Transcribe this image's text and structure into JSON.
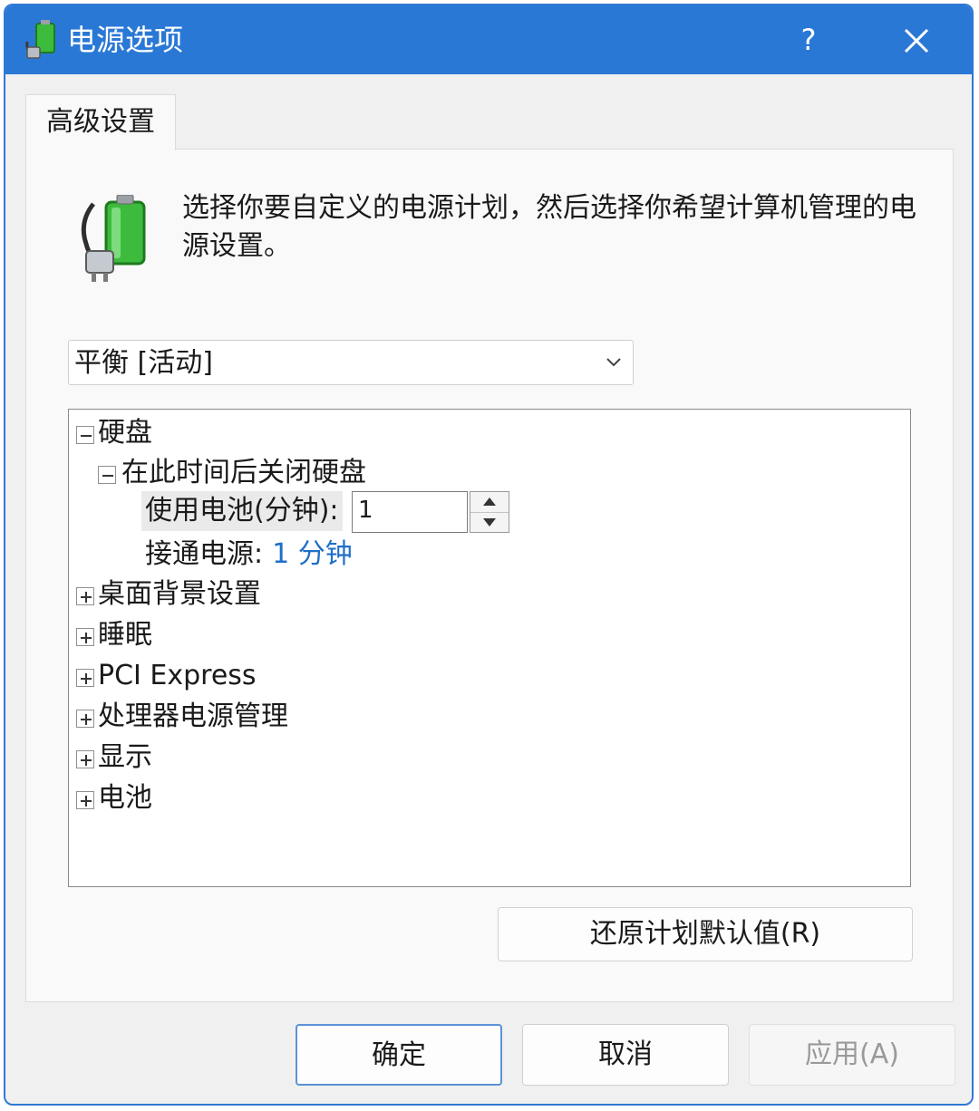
{
  "window": {
    "title": "电源选项",
    "help_label": "?"
  },
  "tab": {
    "label": "高级设置"
  },
  "description": "选择你要自定义的电源计划，然后选择你希望计算机管理的电源设置。",
  "plan_select": {
    "value": "平衡 [活动]"
  },
  "tree": {
    "hard_disk": {
      "label": "硬盘",
      "expanded": true,
      "child": {
        "label": "在此时间后关闭硬盘",
        "expanded": true,
        "on_battery_label": "使用电池(分钟):",
        "on_battery_value": "1",
        "plugged_in_label": "接通电源:",
        "plugged_in_value": "1 分钟"
      }
    },
    "collapsed_items": [
      {
        "label": "桌面背景设置"
      },
      {
        "label": "睡眠"
      },
      {
        "label": "PCI Express"
      },
      {
        "label": "处理器电源管理"
      },
      {
        "label": "显示"
      },
      {
        "label": "电池"
      }
    ]
  },
  "buttons": {
    "restore": "还原计划默认值(R)",
    "ok": "确定",
    "cancel": "取消",
    "apply": "应用(A)"
  },
  "colors": {
    "titlebar": "#2a78d6",
    "link_value": "#1f6fc6",
    "battery_green": "#3dbb3d"
  }
}
